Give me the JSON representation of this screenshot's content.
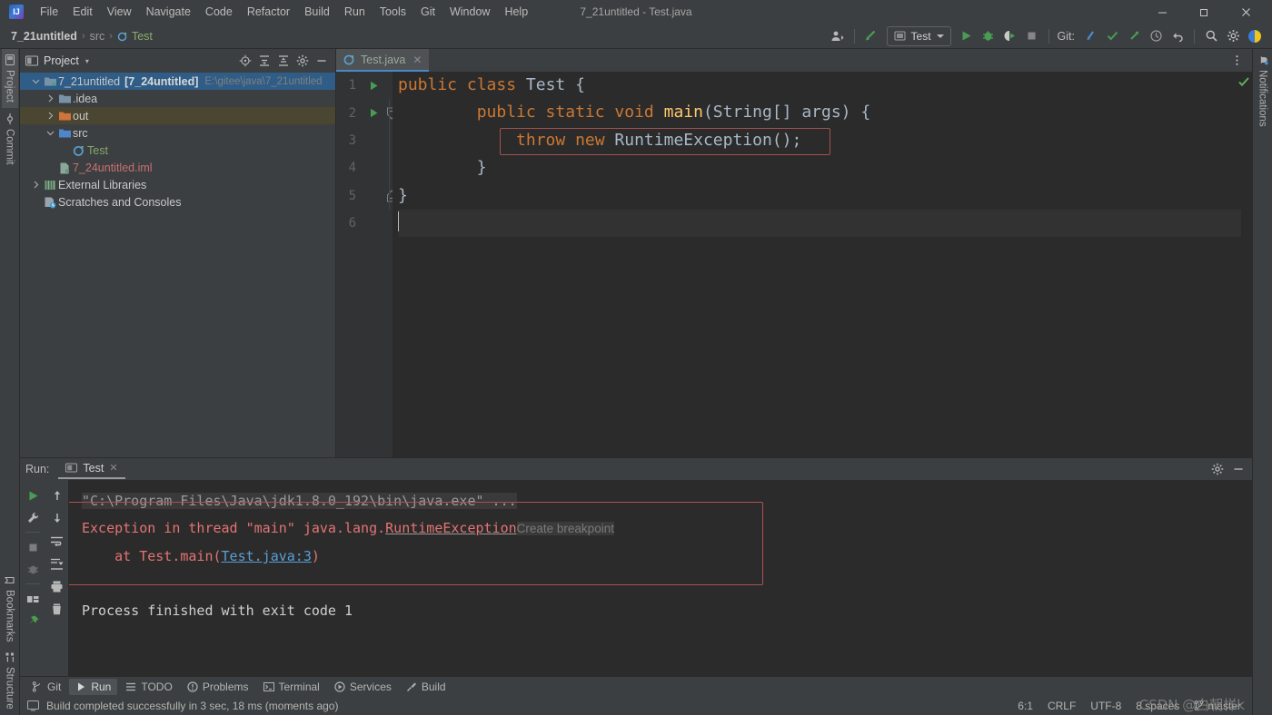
{
  "window": {
    "title": "7_21untitled - Test.java",
    "logo_letter": "IJ",
    "minimize": "—",
    "maximize": "❐",
    "close": "✕"
  },
  "menu": {
    "items": [
      {
        "label": "File"
      },
      {
        "label": "Edit"
      },
      {
        "label": "View"
      },
      {
        "label": "Navigate"
      },
      {
        "label": "Code"
      },
      {
        "label": "Refactor"
      },
      {
        "label": "Build"
      },
      {
        "label": "Run"
      },
      {
        "label": "Tools"
      },
      {
        "label": "Git"
      },
      {
        "label": "Window"
      },
      {
        "label": "Help"
      }
    ]
  },
  "navbar": {
    "crumbs": [
      {
        "label": "7_21untitled",
        "style": "bold"
      },
      {
        "label": "src",
        "style": "dim"
      },
      {
        "label": "Test",
        "style": "class"
      }
    ],
    "separator": "›",
    "run_config": "Test",
    "git_label": "Git:",
    "icons": {
      "account": "account-icon",
      "update_project": "update-project-icon",
      "run": "run-icon",
      "debug": "debug-icon",
      "run_coverage": "run-with-coverage-icon",
      "stop": "stop-icon",
      "git_update": "git-update-icon",
      "git_commit": "git-commit-icon",
      "git_push": "git-push-icon",
      "history": "history-icon",
      "rollback": "rollback-icon",
      "search": "search-everywhere-icon",
      "settings": "settings-icon",
      "ide_assistant": "ide-assistant-icon"
    }
  },
  "left_stripe": {
    "top": [
      {
        "label": "Project",
        "icon": "project-icon",
        "active": true
      },
      {
        "label": "Commit",
        "icon": "commit-icon",
        "active": false
      }
    ],
    "bottom": [
      {
        "label": "Bookmarks",
        "icon": "bookmarks-icon",
        "active": false
      },
      {
        "label": "Structure",
        "icon": "structure-icon",
        "active": false
      }
    ]
  },
  "right_stripe": {
    "items": [
      {
        "label": "Notifications",
        "icon": "notifications-bell-icon",
        "active": false
      }
    ]
  },
  "project_panel": {
    "title": "Project",
    "dropdown_caret": "▾",
    "header_icons": [
      {
        "name": "select-opened-file-icon"
      },
      {
        "name": "expand-all-icon"
      },
      {
        "name": "collapse-all-icon"
      },
      {
        "name": "project-settings-gear-icon"
      },
      {
        "name": "hide-panel-icon"
      }
    ],
    "tree": [
      {
        "indent": 0,
        "arrow": "⌄",
        "expanded": true,
        "icon": "module-icon",
        "name": "7_21untitled",
        "bracket": "[7_24untitled]",
        "path": "E:\\gitee\\java\\7_21untitled",
        "state": "selected"
      },
      {
        "indent": 1,
        "arrow": "›",
        "expanded": false,
        "icon": "folder-icon",
        "name": ".idea",
        "state": "normal"
      },
      {
        "indent": 1,
        "arrow": "›",
        "expanded": false,
        "icon": "folder-out-icon",
        "name": "out",
        "state": "highlight"
      },
      {
        "indent": 1,
        "arrow": "⌄",
        "expanded": true,
        "icon": "folder-src-icon",
        "name": "src",
        "state": "normal"
      },
      {
        "indent": 2,
        "arrow": "",
        "expanded": false,
        "icon": "java-class-icon",
        "name": "Test",
        "state": "class"
      },
      {
        "indent": 1,
        "arrow": "",
        "expanded": false,
        "icon": "iml-file-icon",
        "name": "7_24untitled.iml",
        "state": "iml"
      },
      {
        "indent": 0,
        "arrow": "›",
        "expanded": false,
        "icon": "libraries-icon",
        "name": "External Libraries",
        "state": "normal"
      },
      {
        "indent": 0,
        "arrow": "",
        "expanded": false,
        "icon": "scratches-icon",
        "name": "Scratches and Consoles",
        "state": "normal"
      }
    ]
  },
  "editor": {
    "tab": {
      "label": "Test.java",
      "icon": "java-class-icon",
      "close": "✕"
    },
    "more_menu": "more-options-icon",
    "inspection_status": "inspection-ok-icon",
    "line_numbers": [
      "1",
      "2",
      "3",
      "4",
      "5",
      "6"
    ],
    "gutter_marks": [
      {
        "line": 1,
        "icon": "run-class-gutter-icon"
      },
      {
        "line": 2,
        "icon": "run-method-gutter-icon"
      },
      {
        "line": 2,
        "icon": "fold-collapse-icon"
      },
      {
        "line": 4,
        "icon": "fold-end-icon"
      }
    ],
    "code_lines": [
      {
        "n": 1,
        "tokens": [
          {
            "t": "public ",
            "c": "kw"
          },
          {
            "t": "class ",
            "c": "kw"
          },
          {
            "t": "Test {",
            "c": "cn"
          }
        ]
      },
      {
        "n": 2,
        "tokens": [
          {
            "t": "        ",
            "c": "cn"
          },
          {
            "t": "public static void ",
            "c": "kw"
          },
          {
            "t": "main",
            "c": "mn"
          },
          {
            "t": "(String[] args) {",
            "c": "cn"
          }
        ]
      },
      {
        "n": 3,
        "tokens": [
          {
            "t": "            ",
            "c": "cn"
          },
          {
            "t": "throw new ",
            "c": "kw"
          },
          {
            "t": "RuntimeException();",
            "c": "cn"
          }
        ]
      },
      {
        "n": 4,
        "tokens": [
          {
            "t": "        }",
            "c": "cn"
          }
        ]
      },
      {
        "n": 5,
        "tokens": [
          {
            "t": "}",
            "c": "cn"
          }
        ]
      },
      {
        "n": 6,
        "tokens": [
          {
            "t": "",
            "c": "cn"
          }
        ]
      }
    ]
  },
  "run_panel": {
    "label": "Run:",
    "tab": {
      "label": "Test",
      "icon": "run-config-icon",
      "close": "✕"
    },
    "header_icons": [
      {
        "name": "run-panel-settings-gear-icon"
      },
      {
        "name": "hide-run-panel-icon"
      }
    ],
    "side_buttons": [
      {
        "name": "rerun-icon"
      },
      {
        "name": "modify-run-config-icon"
      },
      {
        "name": "stop-process-icon"
      },
      {
        "name": "debug-process-icon"
      },
      {
        "name": "layout-settings-icon"
      },
      {
        "name": "pin-tab-icon"
      }
    ],
    "side2_buttons": [
      {
        "name": "up-arrow-icon"
      },
      {
        "name": "down-arrow-icon"
      },
      {
        "name": "soft-wrap-icon"
      },
      {
        "name": "scroll-to-end-icon"
      },
      {
        "name": "print-icon"
      },
      {
        "name": "clear-all-icon"
      }
    ],
    "console": {
      "cmd_line": "\"C:\\Program Files\\Java\\jdk1.8.0_192\\bin\\java.exe\" ...",
      "exception_prefix": "Exception in thread \"main\" java.lang.",
      "exception_type": "RuntimeException",
      "create_breakpoint": "Create breakpoint",
      "stack_prefix": "    at Test.main(",
      "stack_link": "Test.java:3",
      "stack_suffix": ")",
      "exit_line": "Process finished with exit code 1"
    }
  },
  "tool_bar": {
    "items": [
      {
        "label": "Git",
        "icon": "git-branch-icon",
        "active": false
      },
      {
        "label": "Run",
        "icon": "run-icon",
        "active": true
      },
      {
        "label": "TODO",
        "icon": "todo-icon",
        "active": false
      },
      {
        "label": "Problems",
        "icon": "problems-icon",
        "active": false
      },
      {
        "label": "Terminal",
        "icon": "terminal-icon",
        "active": false
      },
      {
        "label": "Services",
        "icon": "services-icon",
        "active": false
      },
      {
        "label": "Build",
        "icon": "build-hammer-icon",
        "active": false
      }
    ]
  },
  "status_bar": {
    "icon": "build-status-icon",
    "message": "Build completed successfully in 3 sec, 18 ms (moments ago)",
    "caret_position": "6:1",
    "line_separator": "CRLF",
    "encoding": "UTF-8",
    "indent": "8 spaces",
    "branch": "master",
    "branch_icon": "git-branch-icon"
  },
  "watermark": "CSDN @白朝样k",
  "colors": {
    "accent_blue": "#4a88c7",
    "selection_blue": "#2f5d87",
    "keyword_orange": "#cc7832",
    "method_yellow": "#ffc66d",
    "error_red": "#e57373",
    "link_blue": "#5a9fd4",
    "green": "#499c54",
    "panel_bg": "#3c3f41",
    "editor_bg": "#2b2b2b"
  }
}
